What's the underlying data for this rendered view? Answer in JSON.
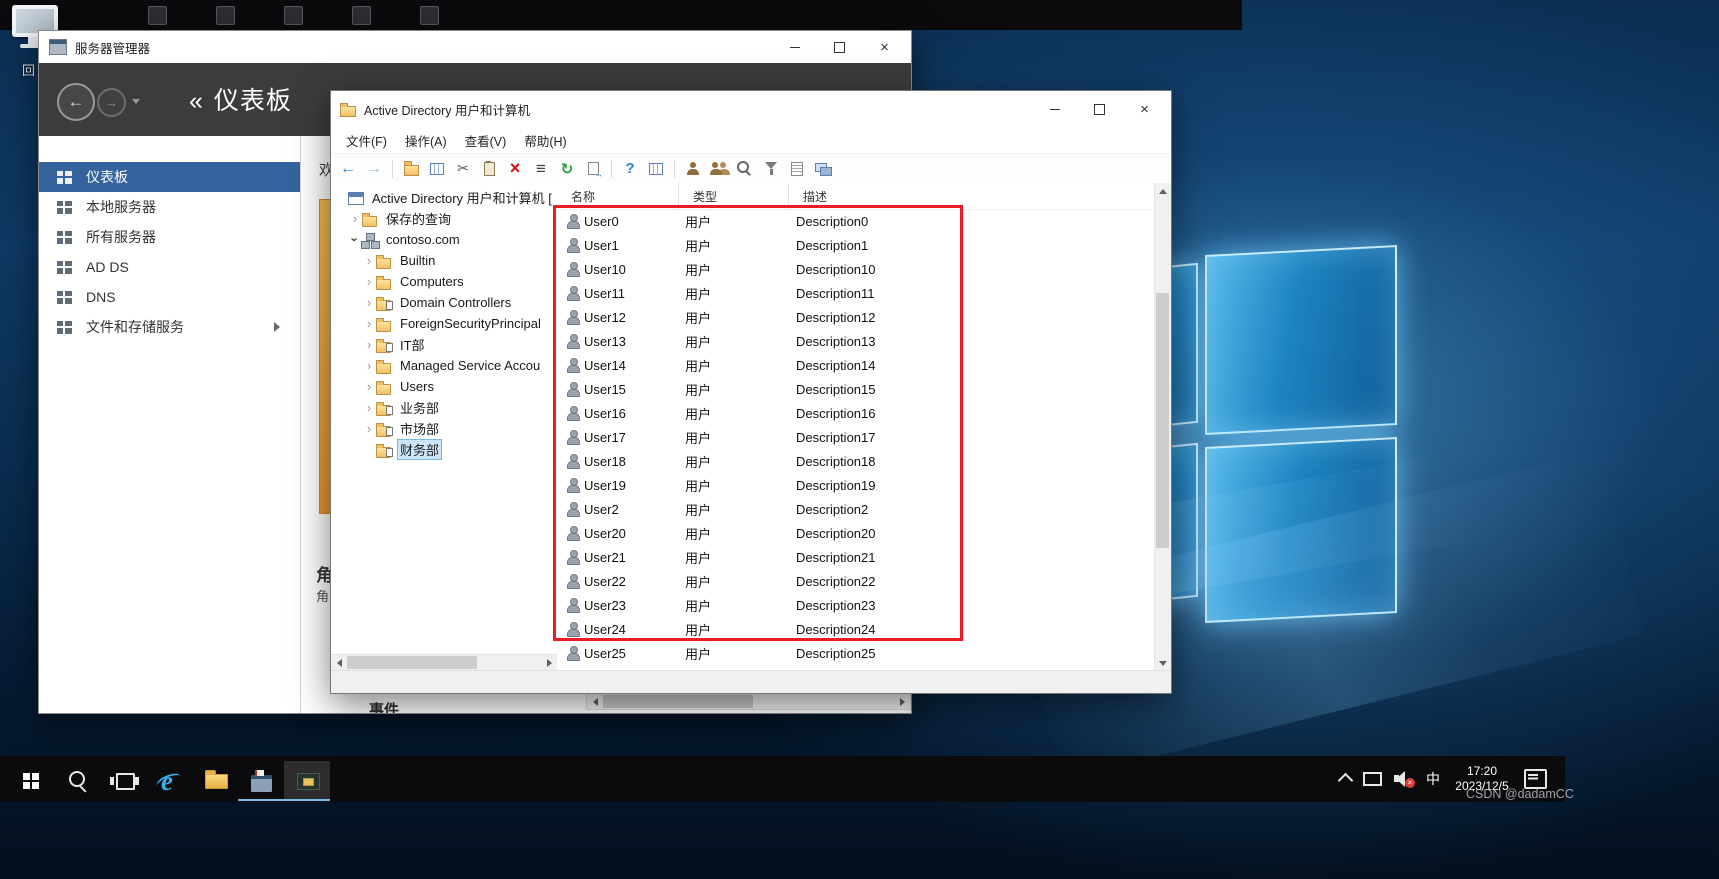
{
  "desktop": {
    "top_shortcut_label": "回",
    "watermark": "CSDN @dadamCC"
  },
  "colors": {
    "annotation_red": "#ec1c24",
    "sidebar_selection_blue": "#35639d",
    "tree_selection_blue": "#cbe6fb",
    "welcome_tile_strip_orange": "#eda63c"
  },
  "server_manager": {
    "window_title": "服务器管理器",
    "nav_back_symbol": "«",
    "nav_title": "仪表板",
    "sidebar_items": [
      {
        "label": "仪表板",
        "icon": "dashboard-icon",
        "selected": true,
        "has_arrow": false
      },
      {
        "label": "本地服务器",
        "icon": "local-server-icon",
        "selected": false,
        "has_arrow": false
      },
      {
        "label": "所有服务器",
        "icon": "all-servers-icon",
        "selected": false,
        "has_arrow": false
      },
      {
        "label": "AD DS",
        "icon": "ad-ds-icon",
        "selected": false,
        "has_arrow": false
      },
      {
        "label": "DNS",
        "icon": "dns-icon",
        "selected": false,
        "has_arrow": false
      },
      {
        "label": "文件和存储服务",
        "icon": "file-storage-icon",
        "selected": false,
        "has_arrow": true
      }
    ],
    "content_fragments": {
      "welcome_partial": "欢",
      "roles_heading_partial": "角",
      "roles_sub_partial": "角",
      "events_label": "事件"
    }
  },
  "aduc": {
    "window_title": "Active Directory 用户和计算机",
    "menu_items": [
      "文件(F)",
      "操作(A)",
      "查看(V)",
      "帮助(H)"
    ],
    "toolbar_icons": [
      {
        "name": "back-icon",
        "kind": "back"
      },
      {
        "name": "forward-icon",
        "kind": "forward"
      },
      {
        "name": "toolbar-separator",
        "kind": "sep"
      },
      {
        "name": "console-tree-icon",
        "kind": "folder"
      },
      {
        "name": "properties-icon",
        "kind": "table"
      },
      {
        "name": "cut-icon",
        "kind": "scissors"
      },
      {
        "name": "paste-icon",
        "kind": "paste"
      },
      {
        "name": "delete-icon",
        "kind": "delete"
      },
      {
        "name": "list-view-icon",
        "kind": "list"
      },
      {
        "name": "refresh-icon",
        "kind": "refresh"
      },
      {
        "name": "export-list-icon",
        "kind": "export"
      },
      {
        "name": "toolbar-separator",
        "kind": "sep"
      },
      {
        "name": "help-icon",
        "kind": "help"
      },
      {
        "name": "view-options-icon",
        "kind": "table"
      },
      {
        "name": "toolbar-separator",
        "kind": "sep"
      },
      {
        "name": "create-user-icon",
        "kind": "person"
      },
      {
        "name": "create-group-icon",
        "kind": "persons"
      },
      {
        "name": "find-icon",
        "kind": "find"
      },
      {
        "name": "filter-icon",
        "kind": "funnel"
      },
      {
        "name": "edit-icon",
        "kind": "edit"
      },
      {
        "name": "computers-icon",
        "kind": "computers"
      }
    ],
    "tree_items": [
      {
        "label": "Active Directory 用户和计算机 [",
        "level": 0,
        "chevron": "none",
        "icon": "aduc-root-icon",
        "selected": false
      },
      {
        "label": "保存的查询",
        "level": 1,
        "chevron": "collapsed",
        "icon": "folder-icon",
        "selected": false
      },
      {
        "label": "contoso.com",
        "level": 1,
        "chevron": "expanded",
        "icon": "domain-icon",
        "selected": false
      },
      {
        "label": "Builtin",
        "level": 2,
        "chevron": "collapsed",
        "icon": "folder-icon",
        "selected": false
      },
      {
        "label": "Computers",
        "level": 2,
        "chevron": "collapsed",
        "icon": "folder-icon",
        "selected": false
      },
      {
        "label": "Domain Controllers",
        "level": 2,
        "chevron": "collapsed",
        "icon": "ou-icon",
        "selected": false
      },
      {
        "label": "ForeignSecurityPrincipal",
        "level": 2,
        "chevron": "collapsed",
        "icon": "folder-icon",
        "selected": false
      },
      {
        "label": "IT部",
        "level": 2,
        "chevron": "collapsed",
        "icon": "ou-icon",
        "selected": false
      },
      {
        "label": "Managed Service Accou",
        "level": 2,
        "chevron": "collapsed",
        "icon": "folder-icon",
        "selected": false
      },
      {
        "label": "Users",
        "level": 2,
        "chevron": "collapsed",
        "icon": "folder-icon",
        "selected": false
      },
      {
        "label": "业务部",
        "level": 2,
        "chevron": "collapsed",
        "icon": "ou-icon",
        "selected": false
      },
      {
        "label": "市场部",
        "level": 2,
        "chevron": "collapsed",
        "icon": "ou-icon",
        "selected": false
      },
      {
        "label": "财务部",
        "level": 2,
        "chevron": "none",
        "icon": "ou-icon",
        "selected": true
      }
    ],
    "list": {
      "columns": [
        "名称",
        "类型",
        "描述"
      ],
      "rows": [
        {
          "name": "User0",
          "type": "用户",
          "description": "Description0"
        },
        {
          "name": "User1",
          "type": "用户",
          "description": "Description1"
        },
        {
          "name": "User10",
          "type": "用户",
          "description": "Description10"
        },
        {
          "name": "User11",
          "type": "用户",
          "description": "Description11"
        },
        {
          "name": "User12",
          "type": "用户",
          "description": "Description12"
        },
        {
          "name": "User13",
          "type": "用户",
          "description": "Description13"
        },
        {
          "name": "User14",
          "type": "用户",
          "description": "Description14"
        },
        {
          "name": "User15",
          "type": "用户",
          "description": "Description15"
        },
        {
          "name": "User16",
          "type": "用户",
          "description": "Description16"
        },
        {
          "name": "User17",
          "type": "用户",
          "description": "Description17"
        },
        {
          "name": "User18",
          "type": "用户",
          "description": "Description18"
        },
        {
          "name": "User19",
          "type": "用户",
          "description": "Description19"
        },
        {
          "name": "User2",
          "type": "用户",
          "description": "Description2"
        },
        {
          "name": "User20",
          "type": "用户",
          "description": "Description20"
        },
        {
          "name": "User21",
          "type": "用户",
          "description": "Description21"
        },
        {
          "name": "User22",
          "type": "用户",
          "description": "Description22"
        },
        {
          "name": "User23",
          "type": "用户",
          "description": "Description23"
        },
        {
          "name": "User24",
          "type": "用户",
          "description": "Description24"
        },
        {
          "name": "User25",
          "type": "用户",
          "description": "Description25"
        }
      ]
    }
  },
  "taskbar": {
    "time": "17:20",
    "date": "2023/12/5",
    "ime_label": "中",
    "app_icons": [
      {
        "name": "start-button",
        "kind": "start",
        "open": false,
        "active": false
      },
      {
        "name": "search-button",
        "kind": "search",
        "open": false,
        "active": false
      },
      {
        "name": "task-view-button",
        "kind": "taskview",
        "open": false,
        "active": false
      },
      {
        "name": "internet-explorer-button",
        "kind": "ie",
        "open": false,
        "active": false
      },
      {
        "name": "file-explorer-button",
        "kind": "explorer",
        "open": false,
        "active": false
      },
      {
        "name": "server-manager-button",
        "kind": "sm",
        "open": true,
        "active": false
      },
      {
        "name": "mmc-console-button",
        "kind": "mmc",
        "open": true,
        "active": true
      }
    ]
  }
}
